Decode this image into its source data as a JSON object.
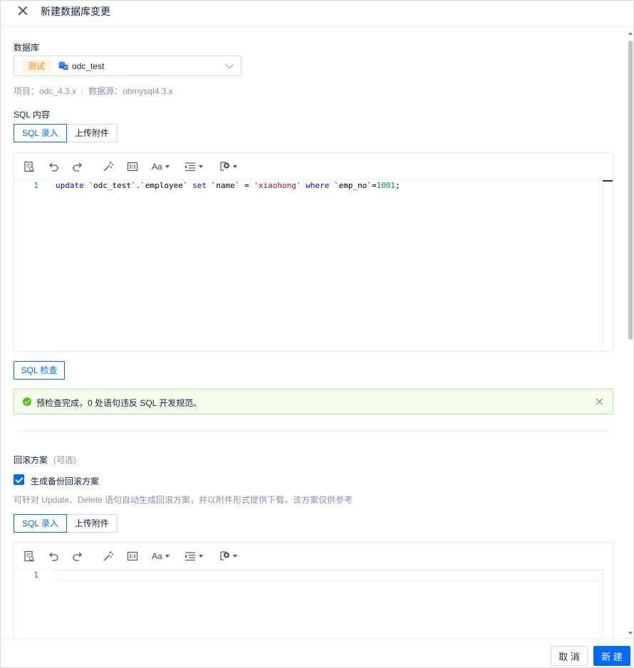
{
  "header": {
    "title": "新建数据库变更"
  },
  "database": {
    "label": "数据库",
    "env_tag": "测试",
    "name": "odc_test",
    "project_label": "项目：",
    "project": "odc_4.3.x",
    "datasource_label": "数据源：",
    "datasource": "obmysql4.3.x"
  },
  "sql_content": {
    "label": "SQL 内容",
    "tabs": [
      "SQL 录入",
      "上传附件"
    ],
    "active_tab": "SQL 录入",
    "line_numbers": [
      "1"
    ],
    "code_tokens": [
      "update",
      " ",
      "`odc_test`",
      ".",
      "`employee`",
      " ",
      "set",
      " ",
      "`name`",
      " = ",
      "'xiaohong'",
      " ",
      "where",
      " ",
      "`emp_no`",
      "=",
      "1001",
      ";"
    ]
  },
  "toolbar_icons": [
    "format-document-icon",
    "undo-icon",
    "redo-icon",
    "magic-wand-icon",
    "full-width-icon",
    "font-size-icon",
    "indent-icon",
    "snippet-add-icon"
  ],
  "toolbar_labels": {
    "font": "Aa"
  },
  "check": {
    "button": "SQL 检查",
    "result": "预检查完成，0 处语句违反 SQL 开发规范。"
  },
  "rollback": {
    "label": "回滚方案",
    "optional": "(可选)",
    "checkbox_label": "生成备份回滚方案",
    "checked": true,
    "hint": "可针对 Update、Delete 语句自动生成回滚方案，并以附件形式提供下载，该方案仅供参考",
    "tabs": [
      "SQL 录入",
      "上传附件"
    ],
    "active_tab": "SQL 录入",
    "line_numbers": [
      "1"
    ]
  },
  "footer": {
    "cancel": "取 消",
    "submit": "新 建"
  },
  "colors": {
    "primary": "#006aff",
    "env_tag_bg": "#fff5e6",
    "env_tag_text": "#fa8c16",
    "success": "#52c41a",
    "success_bg": "#f6ffed"
  }
}
